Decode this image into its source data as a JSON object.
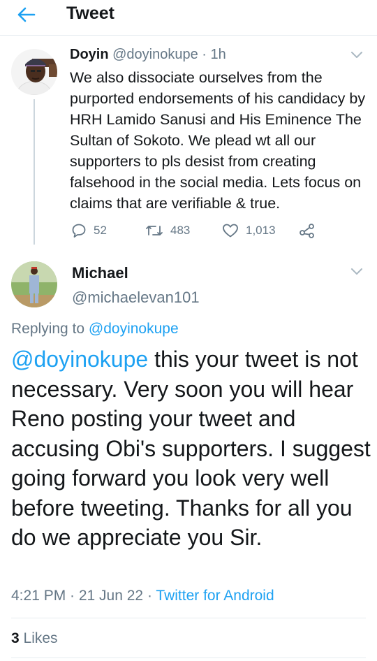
{
  "header": {
    "title": "Tweet"
  },
  "parent_tweet": {
    "name": "Doyin",
    "handle": "@doyinokupe",
    "separator": "·",
    "time": "1h",
    "text": "We also dissociate ourselves from the purported endorsements of his candidacy by HRH Lamido Sanusi and His Eminence The Sultan of Sokoto. We plead wt all our supporters to pls desist from creating falsehood in the social media. Lets focus on claims that are verifiable & true.",
    "replies": "52",
    "retweets": "483",
    "likes": "1,013"
  },
  "reply_tweet": {
    "name": "Michael",
    "handle": "@michaelevan101",
    "replying_to_prefix": "Replying to ",
    "replying_to_handle": "@doyinokupe",
    "mention": "@doyinokupe",
    "text": " this your tweet is not necessary. Very soon you will hear Reno posting your tweet and accusing Obi's supporters. I suggest going forward you look very well before tweeting. Thanks for all you do we appreciate you Sir.",
    "timestamp": "4:21 PM · 21 Jun 22 · ",
    "source": "Twitter for Android",
    "likes_count": "3",
    "likes_label": " Likes"
  },
  "colors": {
    "accent": "#1da1f2",
    "secondary_text": "#657786",
    "divider": "#e6ecf0"
  },
  "icons": [
    "back-arrow-icon",
    "chevron-down-icon",
    "reply-icon",
    "retweet-icon",
    "like-icon",
    "share-icon"
  ]
}
